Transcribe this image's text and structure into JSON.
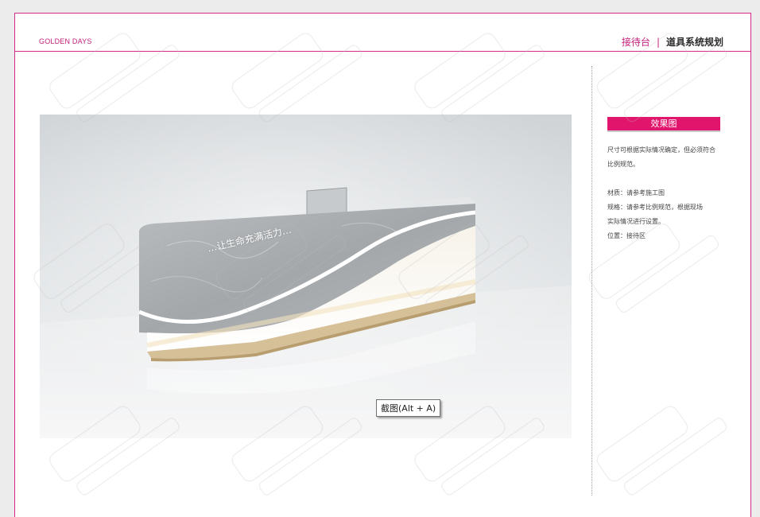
{
  "header": {
    "brand": "GOLDEN DAYS",
    "section": "接待台",
    "separator": "|",
    "title": "道具系统规划"
  },
  "render_image": {
    "overlay_text": "…让生命充满活力…",
    "tooltip": "截图(Alt + A)"
  },
  "side": {
    "heading": "效果图",
    "description": "尺寸可根据实际情况确定，但必须符合比例规范。",
    "specs": [
      "材质：请参考施工图",
      "规格：请参考比例规范，根据现场",
      "实际情况进行设置。",
      "位置：接待区"
    ]
  },
  "colors": {
    "accent": "#e2156d",
    "frame": "#d32b8a",
    "marble": "#a9adb0",
    "base_trim": "#c9ae80"
  }
}
